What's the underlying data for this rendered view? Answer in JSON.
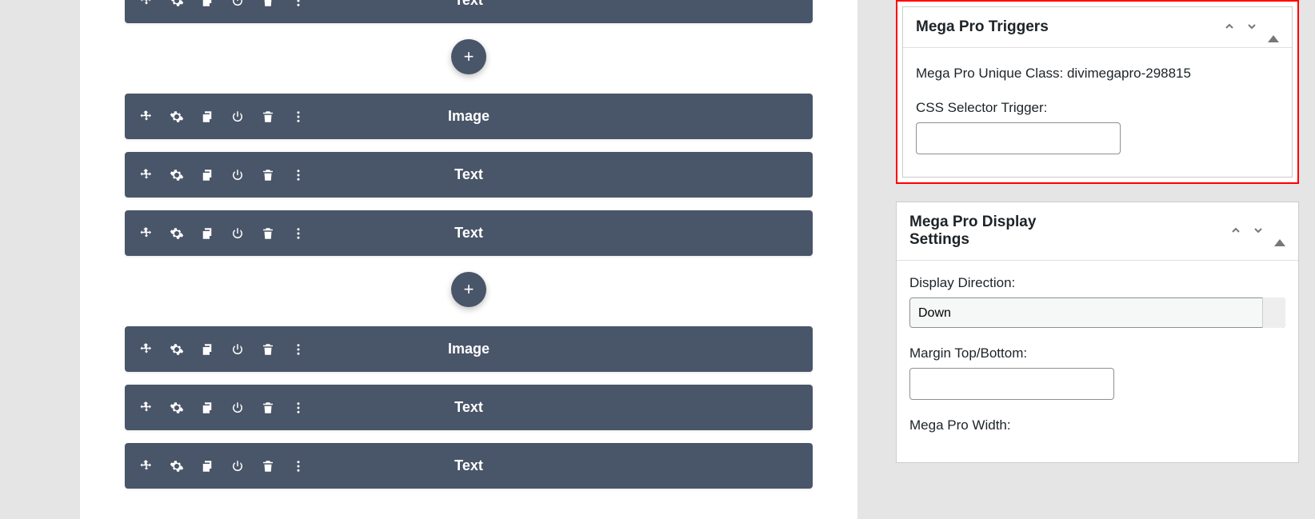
{
  "builder": {
    "groups": [
      {
        "modules": [
          {
            "label": "Text"
          }
        ]
      },
      {
        "modules": [
          {
            "label": "Image"
          },
          {
            "label": "Text"
          },
          {
            "label": "Text"
          }
        ]
      },
      {
        "modules": [
          {
            "label": "Image"
          },
          {
            "label": "Text"
          },
          {
            "label": "Text"
          }
        ]
      }
    ],
    "add_label": "+"
  },
  "sidebar": {
    "triggers": {
      "title": "Mega Pro Triggers",
      "unique_class_label": "Mega Pro Unique Class: divimegapro-298815",
      "css_selector_label": "CSS Selector Trigger:",
      "css_selector_value": ""
    },
    "display": {
      "title": "Mega Pro Display Settings",
      "direction_label": "Display Direction:",
      "direction_value": "Down",
      "margin_label": "Margin Top/Bottom:",
      "margin_value": "",
      "width_label": "Mega Pro Width:"
    }
  }
}
